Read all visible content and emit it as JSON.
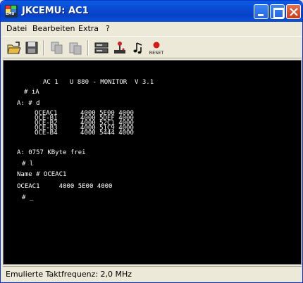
{
  "window": {
    "title": "JKCEMU: AC1"
  },
  "menu": {
    "items": [
      "Datei",
      "Bearbeiten",
      "Extra",
      "?"
    ]
  },
  "toolbar": {
    "reset_label": "RESET"
  },
  "screen": {
    "banner": "AC 1   U 880 - MONITOR  V 3.1",
    "prompt1": "# iA",
    "prompt2": "A: # d",
    "dir_rows": [
      "OCEAC1      4000 5E00 4000",
      "OCE-B1      4000 5DEF 4000",
      "OCE-B2      4000 52C1 4000",
      "OCE-B3      4000 51C9 4000",
      "OCE-B4      4000 5444 4000"
    ],
    "free": "A: 0757 KByte frei",
    "prompt3": "# l",
    "name_prompt": "Name # OCEAC1",
    "load_result": "OCEAC1     4000 5E00 4000",
    "cursor_prompt": "# _"
  },
  "status": {
    "text": "Emulierte Taktfrequenz: 2,0 MHz"
  },
  "colors": {
    "title_bar": "#0a48d0",
    "screen_bg": "#000000",
    "screen_fg": "#ffffff",
    "chrome": "#ece9d8"
  }
}
